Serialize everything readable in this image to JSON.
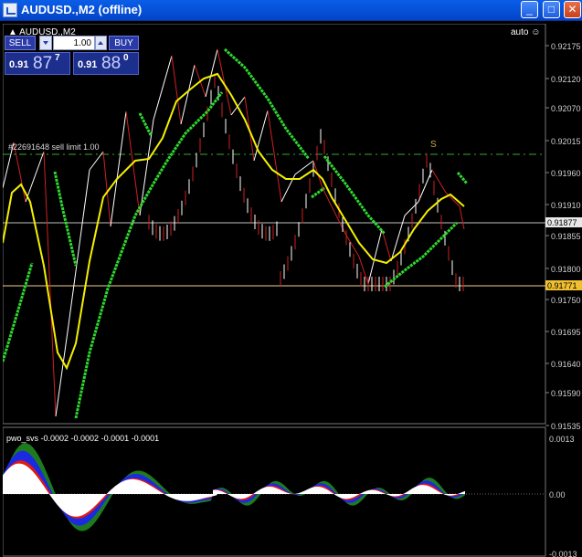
{
  "window": {
    "title": "AUDUSD.,M2 (offline)"
  },
  "chart": {
    "symbol_title": "AUDUSD.,M2",
    "auto_label": "auto",
    "price_scale": [
      "0.92175",
      "0.92120",
      "0.92070",
      "0.92015",
      "0.91960",
      "0.91910",
      "0.91855",
      "0.91800",
      "0.91750",
      "0.91695",
      "0.91640",
      "0.91590",
      "0.91535"
    ],
    "current_price": "0.91877",
    "order_price": "0.91771",
    "order_label": "#22691648 sell limit 1.00",
    "order_marker": "S",
    "colors": {
      "order_line": "#f0d08a",
      "current_line": "#c0c0c0",
      "green_line": "#2fd82f",
      "yellow_line": "#f5f000",
      "up_candle": "#ffffff",
      "down_candle": "#d02020"
    }
  },
  "trade_panel": {
    "sell_label": "SELL",
    "buy_label": "BUY",
    "lot_value": "1.00",
    "sell_price_prefix": "0.91",
    "sell_price_big": "87",
    "sell_price_sup": "7",
    "buy_price_prefix": "0.91",
    "buy_price_big": "88",
    "buy_price_sup": "0"
  },
  "indicator": {
    "label": "pwo_svs -0.0002 -0.0002 -0.0001 -0.0001",
    "scale": [
      "0.0013",
      "0.00",
      "-0.0013"
    ]
  }
}
